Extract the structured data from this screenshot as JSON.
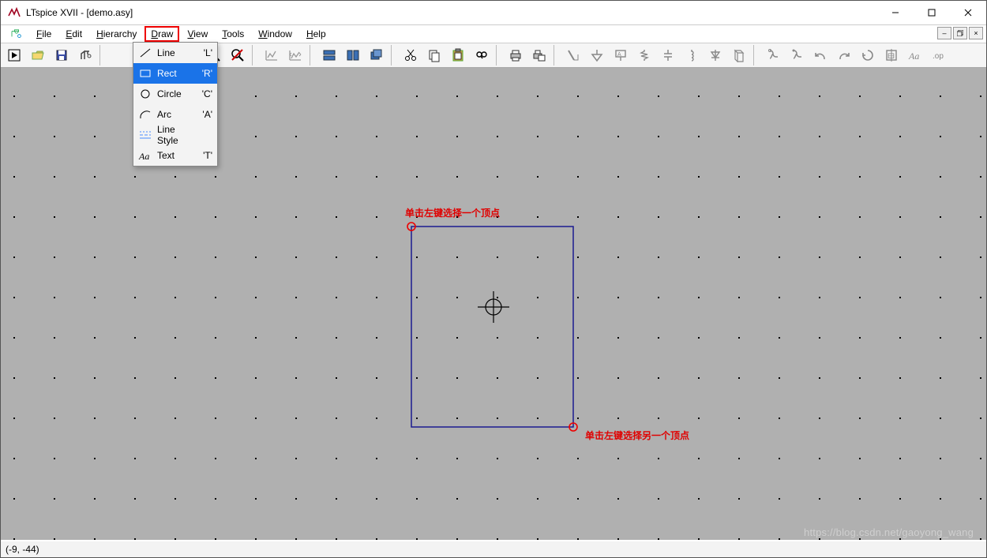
{
  "window": {
    "title": "LTspice XVII - [demo.asy]"
  },
  "menu": {
    "items": [
      {
        "hot": "F",
        "rest": "ile"
      },
      {
        "hot": "E",
        "rest": "dit"
      },
      {
        "hot": "H",
        "rest": "i",
        "tail": "erarchy"
      },
      {
        "hot": "D",
        "rest": "ra",
        "tail": "w",
        "highlight": true
      },
      {
        "hot": "V",
        "rest": "iew"
      },
      {
        "hot": "T",
        "rest": "ools"
      },
      {
        "hot": "W",
        "rest": "indow"
      },
      {
        "hot": "H",
        "rest": "elp"
      }
    ]
  },
  "dropdown": {
    "items": [
      {
        "icon": "line",
        "label": "Line",
        "hotkey": "'L'"
      },
      {
        "icon": "rect",
        "label": "Rect",
        "hotkey": "'R'",
        "selected": true
      },
      {
        "icon": "circle",
        "label": "Circle",
        "hotkey": "'C'"
      },
      {
        "icon": "arc",
        "label": "Arc",
        "hotkey": "'A'"
      },
      {
        "icon": "linestyle",
        "label": "Line Style",
        "hotkey": ""
      },
      {
        "icon": "text",
        "label": "Text",
        "hotkey": "'T'"
      }
    ]
  },
  "annotations": {
    "top": "单击左键选择一个顶点",
    "bottom": "单击左键选择另一个顶点"
  },
  "status": {
    "coords": "(-9, -44)"
  },
  "watermark": "https://blog.csdn.net/gaoyong_wang"
}
